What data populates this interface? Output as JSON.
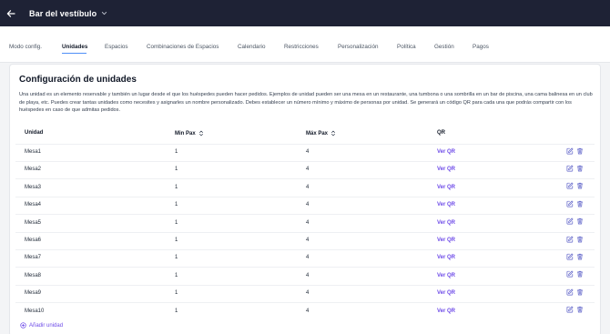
{
  "header": {
    "venue_name": "Bar del vestíbulo",
    "back_icon": "arrow-left-icon",
    "dropdown_icon": "chevron-down-icon"
  },
  "tabs": [
    {
      "label": "Modo config.",
      "active": false
    },
    {
      "label": "Unidades",
      "active": true
    },
    {
      "label": "Espacios",
      "active": false
    },
    {
      "label": "Combinaciones de Espacios",
      "active": false
    },
    {
      "label": "Calendario",
      "active": false
    },
    {
      "label": "Restricciones",
      "active": false
    },
    {
      "label": "Personalización",
      "active": false
    },
    {
      "label": "Política",
      "active": false
    },
    {
      "label": "Gestión",
      "active": false
    },
    {
      "label": "Pagos",
      "active": false
    }
  ],
  "config": {
    "title": "Configuración de unidades",
    "description": "Una unidad es un elemento reservable y también un lugar desde el que los huéspedes pueden hacer pedidos. Ejemplos de unidad pueden ser una mesa en un restaurante, una tumbona o una sombrilla en un bar de piscina, una cama balinesa en un club de playa, etc. Puedes crear tantas unidades como necesites y asignarles un nombre personalizado. Debes establecer un número mínimo y máximo de personas por unidad. Se generará un código QR para cada una que podrás compartir con los huéspedes en caso de que admitas pedidos."
  },
  "table": {
    "columns": {
      "unit": "Unidad",
      "min_pax": "Min Pax",
      "max_pax": "Máx Pax",
      "qr": "QR"
    },
    "rows": [
      {
        "unit": "Mesa1",
        "min": "1",
        "max": "4",
        "qr": "Ver QR"
      },
      {
        "unit": "Mesa2",
        "min": "1",
        "max": "4",
        "qr": "Ver QR"
      },
      {
        "unit": "Mesa3",
        "min": "1",
        "max": "4",
        "qr": "Ver QR"
      },
      {
        "unit": "Mesa4",
        "min": "1",
        "max": "4",
        "qr": "Ver QR"
      },
      {
        "unit": "Mesa5",
        "min": "1",
        "max": "4",
        "qr": "Ver QR"
      },
      {
        "unit": "Mesa6",
        "min": "1",
        "max": "4",
        "qr": "Ver QR"
      },
      {
        "unit": "Mesa7",
        "min": "1",
        "max": "4",
        "qr": "Ver QR"
      },
      {
        "unit": "Mesa8",
        "min": "1",
        "max": "4",
        "qr": "Ver QR"
      },
      {
        "unit": "Mesa9",
        "min": "1",
        "max": "4",
        "qr": "Ver QR"
      },
      {
        "unit": "Mesa10",
        "min": "1",
        "max": "4",
        "qr": "Ver QR"
      }
    ],
    "row_action_icons": [
      "edit-icon",
      "trash-icon"
    ]
  },
  "add_unit": {
    "label": "Añadir unidad",
    "icon": "plus-circle-icon"
  },
  "colors": {
    "header_bg": "#1e2235",
    "accent": "#6d4ae8",
    "tab_underline": "#4f8ff7",
    "page_bg": "#f3f4f6"
  }
}
